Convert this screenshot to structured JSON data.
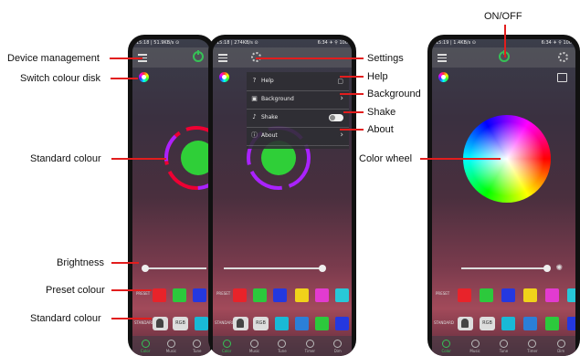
{
  "callouts": {
    "device_management": "Device management",
    "switch_colour_disk": "Switch colour disk",
    "standard_colour_1": "Standard colour",
    "brightness": "Brightness",
    "preset_colour": "Preset colour",
    "standard_colour_2": "Standard colour",
    "settings": "Settings",
    "help": "Help",
    "background": "Background",
    "shake": "Shake",
    "about": "About",
    "on_off": "ON/OFF",
    "color_wheel": "Color wheel"
  },
  "status": {
    "left_phone1": "15:18 | 51.9KB/s ⊙",
    "left_phone2": "15:18 | 274KB/s ⊙",
    "right_phone2": "6:34 ✈ ⚲ 100",
    "left_phone3": "15:19 | 1.4KB/s ⊙",
    "right_phone3": "6:34 ✈ ⚲ 100"
  },
  "settings_menu": {
    "help": "Help",
    "background": "Background",
    "shake": "Shake",
    "about": "About"
  },
  "preset_label": "PRESET",
  "standard_label": "STANDARD",
  "rgb_label": "RGB",
  "tabs": [
    "Color",
    "Music",
    "Tune",
    "Timer",
    "Dim"
  ],
  "colors": {
    "accent_red": "#e21d1d",
    "power_green": "#36c256",
    "preset": [
      "#e8232a",
      "#2cc93c",
      "#2438e0",
      "#f0d21a",
      "#e23bd0",
      "#27c8d8"
    ],
    "standard": [
      "#19b9d6",
      "#2b7fd8",
      "#2cc93c",
      "#2438e0"
    ]
  },
  "icons": [
    "menu-icon",
    "power-icon",
    "gear-icon",
    "colour-disk-icon",
    "image-icon",
    "bulb-icon",
    "question-icon",
    "background-icon",
    "shake-icon",
    "info-icon",
    "chevron-right-icon"
  ]
}
